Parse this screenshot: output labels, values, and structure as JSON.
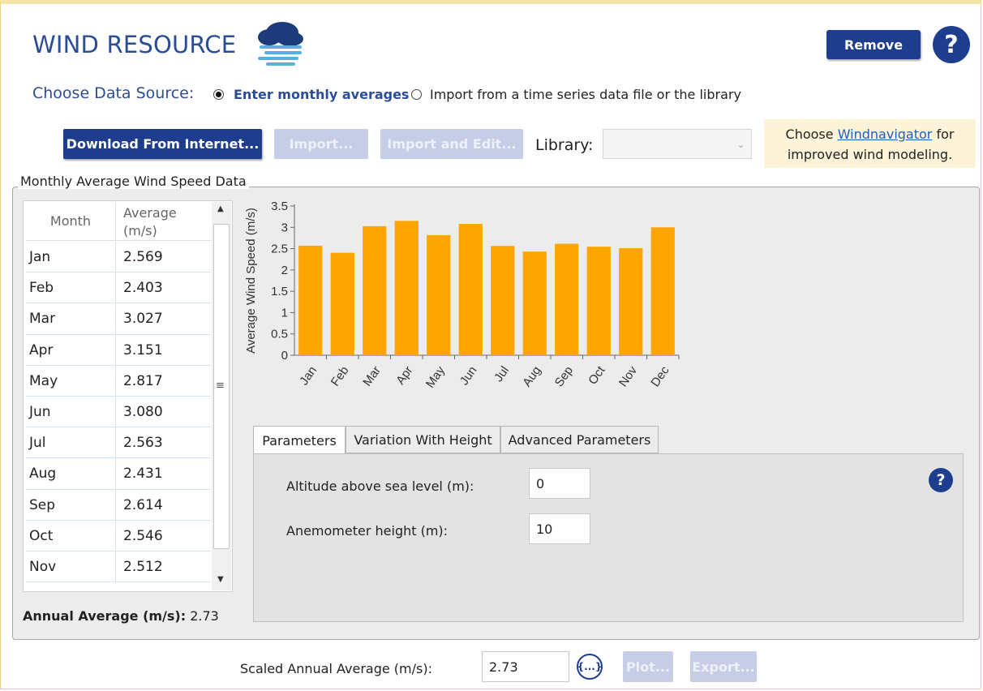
{
  "header": {
    "title": "WIND RESOURCE",
    "remove_label": "Remove",
    "help_label": "?"
  },
  "data_source": {
    "label": "Choose Data Source:",
    "option_monthly": "Enter monthly averages",
    "option_import": "Import from a time series data file or the library",
    "selected": "monthly"
  },
  "toolbar": {
    "download_label": "Download From Internet...",
    "import_label": "Import...",
    "import_edit_label": "Import and Edit...",
    "library_label": "Library:",
    "library_value": ""
  },
  "note": {
    "prefix": "Choose ",
    "link": "Windnavigator",
    "suffix": " for",
    "line2": "improved wind modeling."
  },
  "monthly_group": {
    "title": "Monthly Average Wind Speed Data",
    "col_month": "Month",
    "col_average": "Average (m/s)",
    "rows": [
      {
        "month": "Jan",
        "value": "2.569"
      },
      {
        "month": "Feb",
        "value": "2.403"
      },
      {
        "month": "Mar",
        "value": "3.027"
      },
      {
        "month": "Apr",
        "value": "3.151"
      },
      {
        "month": "May",
        "value": "2.817"
      },
      {
        "month": "Jun",
        "value": "3.080"
      },
      {
        "month": "Jul",
        "value": "2.563"
      },
      {
        "month": "Aug",
        "value": "2.431"
      },
      {
        "month": "Sep",
        "value": "2.614"
      },
      {
        "month": "Oct",
        "value": "2.546"
      },
      {
        "month": "Nov",
        "value": "2.512"
      }
    ],
    "annual_label": "Annual Average (m/s):",
    "annual_value": "2.73"
  },
  "chart_data": {
    "type": "bar",
    "categories": [
      "Jan",
      "Feb",
      "Mar",
      "Apr",
      "May",
      "Jun",
      "Jul",
      "Aug",
      "Sep",
      "Oct",
      "Nov",
      "Dec"
    ],
    "values": [
      2.569,
      2.403,
      3.027,
      3.151,
      2.817,
      3.08,
      2.563,
      2.431,
      2.614,
      2.546,
      2.512,
      3.0
    ],
    "ylabel": "Average Wind Speed (m/s)",
    "xlabel": "",
    "ylim": [
      0,
      3.5
    ],
    "yticks": [
      "0",
      "0.5",
      "1",
      "1.5",
      "2",
      "2.5",
      "3",
      "3.5"
    ],
    "bar_color": "#ffa500",
    "grid": false
  },
  "tabs": [
    {
      "label": "Parameters",
      "active": true
    },
    {
      "label": "Variation With Height",
      "active": false
    },
    {
      "label": "Advanced Parameters",
      "active": false
    }
  ],
  "parameters": {
    "altitude_label": "Altitude above sea level (m):",
    "altitude_value": "0",
    "anemometer_label": "Anemometer height (m):",
    "anemometer_value": "10",
    "help_label": "?"
  },
  "footer": {
    "scaled_label": "Scaled Annual Average (m/s):",
    "scaled_value": "2.73",
    "ellipsis_label": "{...}",
    "plot_label": "Plot...",
    "export_label": "Export..."
  }
}
